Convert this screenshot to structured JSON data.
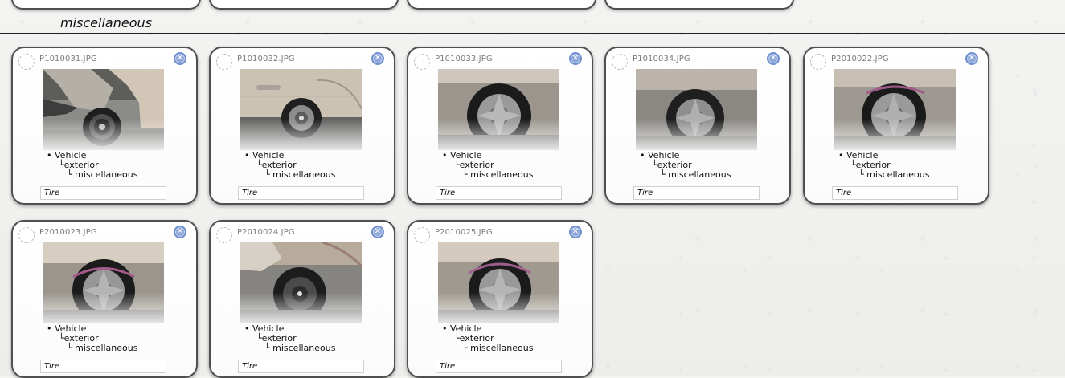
{
  "section": {
    "title": "miscellaneous"
  },
  "cards": [
    {
      "filename": "P1010031.JPG",
      "tree": [
        "Vehicle",
        "exterior",
        "miscellaneous"
      ],
      "tag_value": "Tire"
    },
    {
      "filename": "P1010032.JPG",
      "tree": [
        "Vehicle",
        "exterior",
        "miscellaneous"
      ],
      "tag_value": "Tire"
    },
    {
      "filename": "P1010033.JPG",
      "tree": [
        "Vehicle",
        "exterior",
        "miscellaneous"
      ],
      "tag_value": "Tire"
    },
    {
      "filename": "P1010034.JPG",
      "tree": [
        "Vehicle",
        "exterior",
        "miscellaneous"
      ],
      "tag_value": "Tire"
    },
    {
      "filename": "P2010022.JPG",
      "tree": [
        "Vehicle",
        "exterior",
        "miscellaneous"
      ],
      "tag_value": "Tire"
    },
    {
      "filename": "P2010023.JPG",
      "tree": [
        "Vehicle",
        "exterior",
        "miscellaneous"
      ],
      "tag_value": "Tire"
    },
    {
      "filename": "P2010024.JPG",
      "tree": [
        "Vehicle",
        "exterior",
        "miscellaneous"
      ],
      "tag_value": "Tire"
    },
    {
      "filename": "P2010025.JPG",
      "tree": [
        "Vehicle",
        "exterior",
        "miscellaneous"
      ],
      "tag_value": "Tire"
    }
  ],
  "icons": {
    "select": "select-circle-icon",
    "close": "close-circle-icon"
  },
  "colors": {
    "close_button": "#7f9ad7",
    "card_border": "#4f4f4f",
    "header_rule": "#222222"
  }
}
